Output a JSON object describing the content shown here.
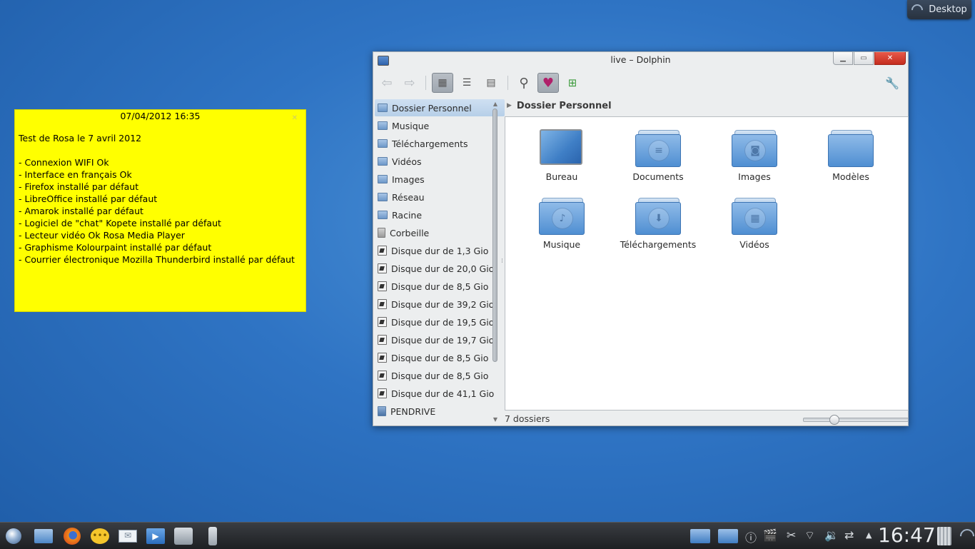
{
  "desktop": {
    "button_label": "Desktop"
  },
  "note": {
    "date": "07/04/2012 16:35",
    "lines": [
      "Test de Rosa le 7 avril 2012",
      "- Connexion WIFI Ok",
      "- Interface en français Ok",
      "- Firefox installé par défaut",
      "- LibreOffice installé par défaut",
      "- Amarok installé par défaut",
      "- Logiciel de \"chat\" Kopete installé par défaut",
      "- Lecteur vidéo Ok Rosa Media Player",
      "- Graphisme Kolourpaint installé par défaut",
      "- Courrier électronique Mozilla Thunderbird installé par défaut"
    ]
  },
  "dolphin": {
    "title": "live – Dolphin",
    "places": [
      {
        "label": "Dossier Personnel",
        "icon": "home-icon",
        "selected": true
      },
      {
        "label": "Musique",
        "icon": "folder-music-icon"
      },
      {
        "label": "Téléchargements",
        "icon": "folder-downloads-icon"
      },
      {
        "label": "Vidéos",
        "icon": "folder-videos-icon"
      },
      {
        "label": "Images",
        "icon": "folder-images-icon"
      },
      {
        "label": "Réseau",
        "icon": "network-icon"
      },
      {
        "label": "Racine",
        "icon": "folder-root-icon"
      },
      {
        "label": "Corbeille",
        "icon": "trash-icon"
      },
      {
        "label": "Disque dur de 1,3 Gio",
        "icon": "harddisk-icon"
      },
      {
        "label": "Disque dur de 20,0 Gio",
        "icon": "harddisk-icon"
      },
      {
        "label": "Disque dur de 8,5 Gio",
        "icon": "harddisk-icon"
      },
      {
        "label": "Disque dur de 39,2 Gio",
        "icon": "harddisk-icon"
      },
      {
        "label": "Disque dur de 19,5 Gio",
        "icon": "harddisk-icon"
      },
      {
        "label": "Disque dur de 19,7 Gio",
        "icon": "harddisk-icon"
      },
      {
        "label": "Disque dur de 8,5 Gio",
        "icon": "harddisk-icon"
      },
      {
        "label": "Disque dur de 8,5 Gio",
        "icon": "harddisk-icon"
      },
      {
        "label": "Disque dur de 41,1 Gio",
        "icon": "harddisk-icon"
      },
      {
        "label": "PENDRIVE",
        "icon": "usb-drive-icon"
      }
    ],
    "breadcrumb": "Dossier Personnel",
    "items": [
      {
        "label": "Bureau",
        "icon": "desktop-folder-icon"
      },
      {
        "label": "Documents",
        "icon": "folder-documents-icon"
      },
      {
        "label": "Images",
        "icon": "folder-images-icon"
      },
      {
        "label": "Modèles",
        "icon": "folder-templates-icon"
      },
      {
        "label": "Musique",
        "icon": "folder-music-icon"
      },
      {
        "label": "Téléchargements",
        "icon": "folder-downloads-icon"
      },
      {
        "label": "Vidéos",
        "icon": "folder-videos-icon"
      }
    ],
    "status": "7 dossiers",
    "zoom_fraction": 0.27
  },
  "taskbar": {
    "clock": "16:47",
    "launchers": [
      "rosa-menu-icon",
      "file-manager-icon",
      "firefox-icon",
      "chat-icon",
      "mail-icon",
      "media-player-icon",
      "screenshot-icon",
      "usb-device-icon"
    ],
    "tray": [
      "folder-icon",
      "folder-icon",
      "info-icon",
      "clapper-icon",
      "scissors-icon",
      "wifi-icon",
      "volume-icon",
      "network-icon",
      "arrow-up-icon"
    ]
  }
}
